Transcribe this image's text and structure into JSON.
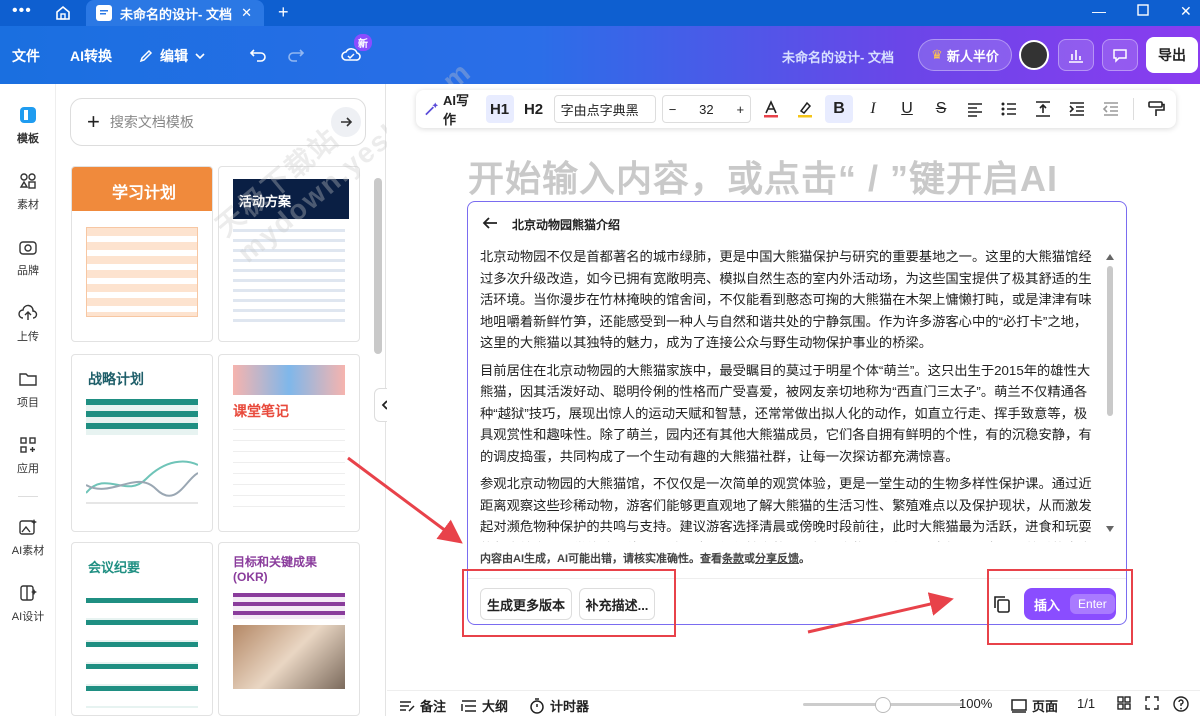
{
  "window": {
    "tab_title": "未命名的设计- 文档",
    "controls": [
      "minimize",
      "maximize",
      "close"
    ]
  },
  "toolbar": {
    "file_label": "文件",
    "ai_convert_label": "AI转换",
    "edit_label": "编辑",
    "new_badge": "新",
    "doc_title": "未命名的设计- 文档",
    "promo_label": "新人半价",
    "export_label": "导出"
  },
  "rail": [
    {
      "label": "模板",
      "icon": "template-icon"
    },
    {
      "label": "素材",
      "icon": "material-icon"
    },
    {
      "label": "品牌",
      "icon": "brand-icon"
    },
    {
      "label": "上传",
      "icon": "upload-icon"
    },
    {
      "label": "项目",
      "icon": "folder-icon"
    },
    {
      "label": "应用",
      "icon": "apps-icon"
    },
    {
      "label": "AI素材",
      "icon": "ai-material-icon"
    },
    {
      "label": "AI设计",
      "icon": "ai-design-icon"
    }
  ],
  "panel": {
    "search_placeholder": "搜索文档模板",
    "templates": [
      {
        "title": "学习计划",
        "color": "#f08a3c"
      },
      {
        "title": "活动方案",
        "color": "#0a1f44"
      },
      {
        "title": "战略计划",
        "color": "#1f8f82"
      },
      {
        "title": "课堂笔记",
        "color": "#e84a3c"
      },
      {
        "title": "会议纪要",
        "color": "#1f8f82"
      },
      {
        "title": "目标和关键成果(OKR)",
        "color": "#8a3c9c"
      }
    ]
  },
  "format": {
    "ai_write_label": "AI写作",
    "h1": "H1",
    "h2": "H2",
    "font_name": "字由点字典黑",
    "font_size": "32",
    "minus": "−",
    "plus": "+",
    "bold": "B",
    "italic": "I",
    "underline": "U",
    "strike": "S"
  },
  "editor": {
    "placeholder": "开始输入内容，或点击“ / ”键开启AI"
  },
  "ai_panel": {
    "title": "北京动物园熊猫介绍",
    "paragraphs": [
      "北京动物园不仅是首都著名的城市绿肺，更是中国大熊猫保护与研究的重要基地之一。这里的大熊猫馆经过多次升级改造，如今已拥有宽敞明亮、模拟自然生态的室内外活动场，为这些国宝提供了极其舒适的生活环境。当你漫步在竹林掩映的馆舍间，不仅能看到憨态可掬的大熊猫在木架上慵懒打盹，或是津津有味地咀嚼着新鲜竹笋，还能感受到一种人与自然和谐共处的宁静氛围。作为许多游客心中的“必打卡”之地，这里的大熊猫以其独特的魅力，成为了连接公众与野生动物保护事业的桥梁。",
      "目前居住在北京动物园的大熊猫家族中，最受瞩目的莫过于明星个体“萌兰”。这只出生于2015年的雄性大熊猫，因其活泼好动、聪明伶俐的性格而广受喜爱，被网友亲切地称为“西直门三太子”。萌兰不仅精通各种“越狱”技巧，展现出惊人的运动天赋和智慧，还常常做出拟人化的动作，如直立行走、挥手致意等，极具观赏性和趣味性。除了萌兰，园内还有其他大熊猫成员，它们各自拥有鲜明的个性，有的沉稳安静，有的调皮捣蛋，共同构成了一个生动有趣的大熊猫社群，让每一次探访都充满惊喜。",
      "参观北京动物园的大熊猫馆，不仅仅是一次简单的观赏体验，更是一堂生动的生物多样性保护课。通过近距离观察这些珍稀动物，游客们能够更直观地了解大熊猫的生活习性、繁殖难点以及保护现状，从而激发起对濒危物种保护的共鸣与支持。建议游客选择清晨或傍晚时段前往，此时大熊猫最为活跃，进食和玩耍的频率较高，观赏体验最佳。同时，请记得保持安静，不投喂食物，不使用闪光灯，用文明且尊重的态度去欣赏这些来自远"
    ],
    "disclaimer_prefix": "内容由AI生成，AI可能出错，请核实准确性。查看",
    "terms_link": "条款",
    "or": "或",
    "feedback_link": "分享反馈",
    "period": "。",
    "more_versions_label": "生成更多版本",
    "supplement_label": "补充描述...",
    "insert_label": "插入",
    "enter_label": "Enter"
  },
  "status": {
    "notes_label": "备注",
    "outline_label": "大纲",
    "timer_label": "计时器",
    "zoom": "100%",
    "zoom_level": 0.5,
    "pages_label": "页面",
    "page_count": "1/1"
  },
  "watermark": "天极下载站 mydown.yesky.com",
  "colors": {
    "accent_purple": "#8a4dff",
    "annotation_red": "#e8424a",
    "brand_blue": "#1a6fe0"
  }
}
